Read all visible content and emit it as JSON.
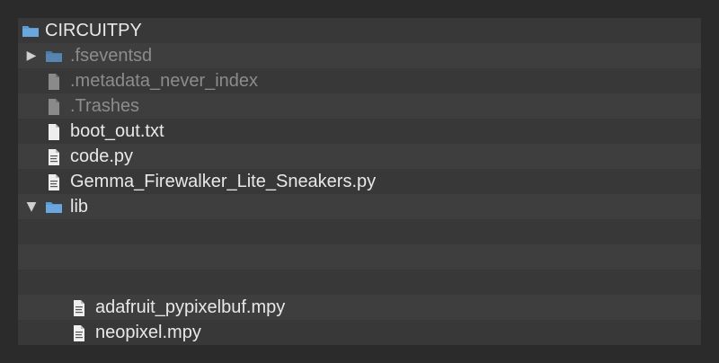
{
  "window": {
    "title": "CIRCUITPY"
  },
  "tree": {
    "root": {
      "label": "CIRCUITPY",
      "icon": "folder-icon",
      "color": "#5b9bd5"
    },
    "items": [
      {
        "label": ".fseventsd",
        "icon": "folder-icon",
        "hidden": true,
        "expanded": false
      },
      {
        "label": ".metadata_never_index",
        "icon": "file-icon",
        "hidden": true
      },
      {
        "label": ".Trashes",
        "icon": "file-icon",
        "hidden": true
      },
      {
        "label": "boot_out.txt",
        "icon": "text-file-icon",
        "hidden": false
      },
      {
        "label": "code.py",
        "icon": "script-file-icon",
        "hidden": false
      },
      {
        "label": "Gemma_Firewalker_Lite_Sneakers.py",
        "icon": "script-file-icon",
        "hidden": false
      },
      {
        "label": "lib",
        "icon": "folder-icon",
        "hidden": false,
        "expanded": true
      },
      {
        "label": "adafruit_pypixelbuf.mpy",
        "icon": "script-file-icon",
        "hidden": false
      },
      {
        "label": "neopixel.mpy",
        "icon": "script-file-icon",
        "hidden": false
      }
    ]
  },
  "glyphs": {
    "collapsed": "▶",
    "expanded": "▼"
  },
  "colors": {
    "background": "#2b2b2b",
    "panel": "#383838",
    "row_alt": "#3e3e3e",
    "text": "#e8e8e8",
    "hidden_text": "#8c8c8c",
    "folder": "#5b9bd5"
  }
}
